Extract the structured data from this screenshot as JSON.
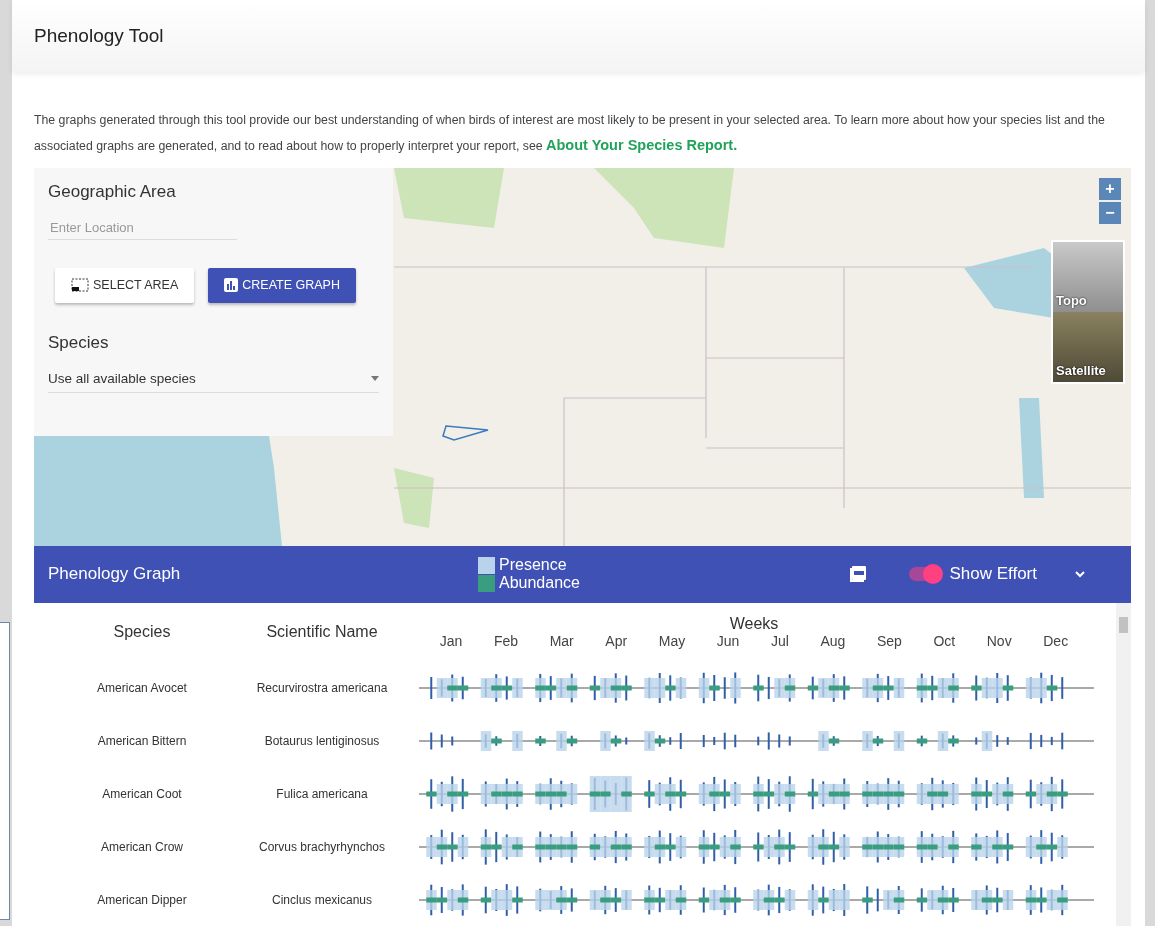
{
  "header": {
    "title": "Phenology Tool"
  },
  "intro": {
    "text": "The graphs generated through this tool provide our best understanding of when birds of interest are most likely to be present in your selected area.  To learn more about how your species list and the associated graphs are generated, and to read about how to properly interpret your report, see ",
    "link": "About Your Species Report."
  },
  "geographic_panel": {
    "title": "Geographic Area",
    "location_placeholder": "Enter Location",
    "buttons": [
      {
        "kind": "outline",
        "label": "SELECT AREA"
      },
      {
        "kind": "primary",
        "label": "CREATE GRAPH"
      }
    ],
    "species_title": "Species",
    "species_select": "Use all available species"
  },
  "map": {
    "zoom_buttons": [
      "+",
      "−"
    ],
    "layers": [
      {
        "kind": "topo",
        "label": "Topo"
      },
      {
        "kind": "satellite",
        "label": "Satellite"
      }
    ]
  },
  "graph_bar": {
    "title": "Phenology Graph",
    "legend": [
      {
        "label": "Presence",
        "color": "#b9d3ea"
      },
      {
        "label": "Abundance",
        "color": "#3a9d7f"
      }
    ],
    "show_effort": {
      "label": "Show Effort",
      "on": true
    }
  },
  "table": {
    "columns": [
      "Species",
      "Scientific Name"
    ],
    "weeks_label": "Weeks",
    "months": [
      "Jan",
      "Feb",
      "Mar",
      "Apr",
      "May",
      "Jun",
      "Jul",
      "Aug",
      "Sep",
      "Oct",
      "Nov",
      "Dec"
    ],
    "rows": [
      {
        "species": "American Avocet",
        "scientific": "Recurvirostra americana"
      },
      {
        "species": "American Bittern",
        "scientific": "Botaurus lentiginosus"
      },
      {
        "species": "American Coot",
        "scientific": "Fulica americana"
      },
      {
        "species": "American Crow",
        "scientific": "Corvus brachyrhynchos"
      },
      {
        "species": "American Dipper",
        "scientific": "Cinclus mexicanus"
      }
    ]
  }
}
